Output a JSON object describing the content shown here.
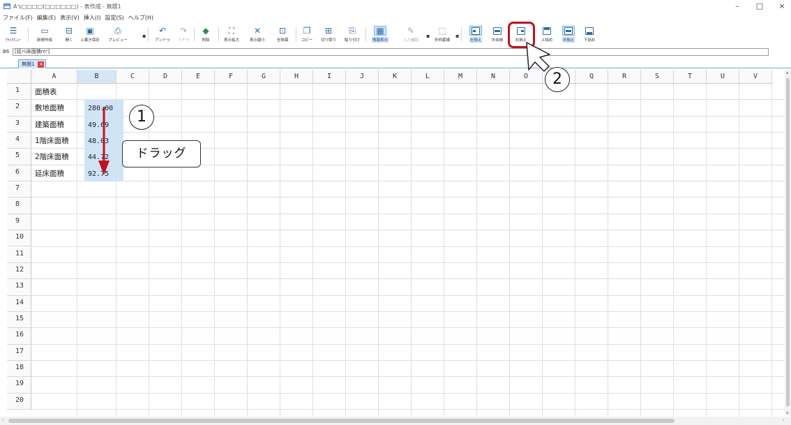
{
  "window": {
    "title": "A's□□□□(□□□□□□) - 表作成 - 無題1",
    "controls": [
      "–",
      "□",
      "×"
    ]
  },
  "menu": [
    "ファイル(F)",
    "編集(E)",
    "表示(V)",
    "挿入(I)",
    "設定(S)",
    "ヘルプ(H)"
  ],
  "toolbar": {
    "quick_menu": "ｸｲｯｸﾒﾆｭｰ",
    "new": "新規作成",
    "open": "開く",
    "save": "上書き保存",
    "preview": "プレビュー",
    "undo": "アンドゥ",
    "redo": "リドゥ",
    "delete": "削除",
    "zoom_in": "表示拡大",
    "zoom_out": "表示縮小",
    "fit_all": "全体図",
    "copy": "コピー",
    "cut": "切り取り",
    "paste": "貼り付け",
    "grid_display": "情報表示",
    "input_assist": "入力補助",
    "border": "外枠罫線",
    "align_left": "左揃え",
    "align_center": "中央揃",
    "align_right": "右揃え",
    "align_top": "上詰め",
    "align_middle": "中揃え",
    "align_bottom": "下詰め"
  },
  "formula_bar": {
    "cell_ref": "B6",
    "content": "[延べ床面積m²]"
  },
  "sheet_tab": {
    "name": "無題1",
    "close": "×"
  },
  "grid": {
    "columns": [
      "A",
      "B",
      "C",
      "D",
      "E",
      "F",
      "G",
      "H",
      "I",
      "J",
      "K",
      "L",
      "M",
      "N",
      "O",
      "P",
      "Q",
      "R",
      "S",
      "T",
      "U",
      "V"
    ],
    "rows": [
      "1",
      "2",
      "3",
      "4",
      "5",
      "6",
      "7",
      "8",
      "9",
      "10",
      "11",
      "12",
      "13",
      "14",
      "15",
      "16",
      "17",
      "18",
      "19",
      "20"
    ],
    "cells": {
      "A1": "面積表",
      "A2": "敷地面積",
      "B2": "280.00",
      "A3": "建築面積",
      "B3": "49.69",
      "A4": "1階床面積",
      "B4": "48.03",
      "A5": "2階床面積",
      "B5": "44.72",
      "A6": "延床面積",
      "B6": "92.75"
    },
    "selected_range": "B2:B6"
  },
  "annotations": {
    "step1": "1",
    "step2": "2",
    "drag_label": "ドラッグ",
    "arrow_color": "#c0121e",
    "highlight_color": "#c0121e"
  }
}
